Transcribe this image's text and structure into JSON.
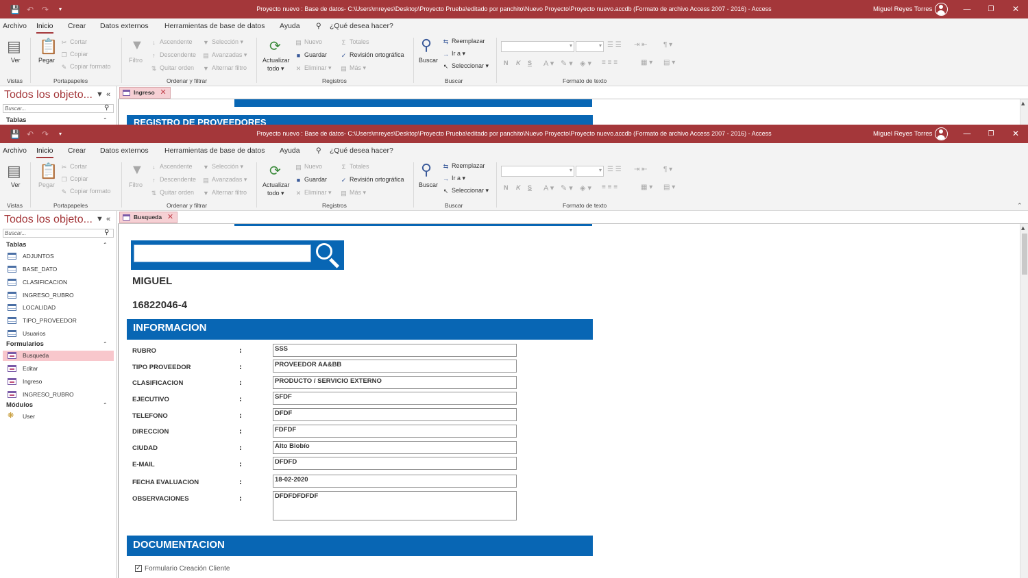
{
  "window": {
    "title": "Proyecto nuevo : Base de datos- C:\\Users\\mreyes\\Desktop\\Proyecto Prueba\\editado por panchito\\Nuevo Proyecto\\Proyecto nuevo.accdb (Formato de archivo Access 2007 - 2016)  -  Access",
    "user": "Miguel Reyes Torres",
    "brand_color": "#a4373a"
  },
  "menu": {
    "archivo": "Archivo",
    "inicio": "Inicio",
    "crear": "Crear",
    "datos_externos": "Datos externos",
    "herramientas": "Herramientas de base de datos",
    "ayuda": "Ayuda",
    "tell_me": "¿Qué desea hacer?"
  },
  "ribbon": {
    "ver": "Ver",
    "vistas": "Vistas",
    "pegar": "Pegar",
    "cortar": "Cortar",
    "copiar": "Copiar",
    "copiar_formato": "Copiar formato",
    "portapapeles": "Portapapeles",
    "filtro": "Filtro",
    "ascendente": "Ascendente",
    "descendente": "Descendente",
    "quitar_orden": "Quitar orden",
    "seleccion": "Selección",
    "avanzadas": "Avanzadas",
    "alternar_filtro": "Alternar filtro",
    "ordenar_filtrar": "Ordenar y filtrar",
    "actualizar": "Actualizar",
    "todo": "todo",
    "nuevo": "Nuevo",
    "guardar": "Guardar",
    "eliminar": "Eliminar",
    "totales": "Totales",
    "revision": "Revisión ortográfica",
    "mas": "Más",
    "registros": "Registros",
    "buscar_btn": "Buscar",
    "reemplazar": "Reemplazar",
    "ir_a": "Ir a",
    "seleccionar": "Seleccionar",
    "buscar_group": "Buscar",
    "formato_texto": "Formato de texto",
    "bold": "N",
    "italic": "K",
    "underline": "S"
  },
  "nav": {
    "title": "Todos los objeto...",
    "search_placeholder": "Buscar...",
    "groups": {
      "tablas": "Tablas",
      "formularios": "Formularios",
      "modulos": "Módulos"
    },
    "tables": [
      "ADJUNTOS",
      "BASE_DATO",
      "CLASIFICACION",
      "INGRESO_RUBRO",
      "LOCALIDAD",
      "TIPO_PROVEEDOR",
      "Usuarios"
    ],
    "forms": [
      "Busqueda",
      "Editar",
      "Ingreso",
      "INGRESO_RUBRO"
    ],
    "modules": [
      "User"
    ]
  },
  "back_window": {
    "tab": "Ingreso",
    "form_header": "REGISTRO DE PROVEEDORES"
  },
  "front_window": {
    "tab": "Busqueda",
    "name": "MIGUEL",
    "rut": "16822046-4",
    "section_info": "INFORMACION",
    "section_doc": "DOCUMENTACION",
    "fields": [
      {
        "label": "RUBRO",
        "value": "SSS"
      },
      {
        "label": "TIPO PROVEEDOR",
        "value": "PROVEEDOR AA&BB"
      },
      {
        "label": "CLASIFICACION",
        "value": "PRODUCTO / SERVICIO EXTERNO"
      },
      {
        "label": "EJECUTIVO",
        "value": "SFDF"
      },
      {
        "label": "TELEFONO",
        "value": "DFDF"
      },
      {
        "label": "DIRECCION",
        "value": "FDFDF"
      },
      {
        "label": "CIUDAD",
        "value": "Alto Biobío"
      },
      {
        "label": "E-MAIL",
        "value": "DFDFD"
      },
      {
        "label": "FECHA EVALUACION",
        "value": "18-02-2020"
      },
      {
        "label": "OBSERVACIONES",
        "value": "DFDFDFDFDF"
      }
    ],
    "colon": ":",
    "checkbox_label": "Formulario Creación Cliente",
    "checkbox_checked": true
  }
}
